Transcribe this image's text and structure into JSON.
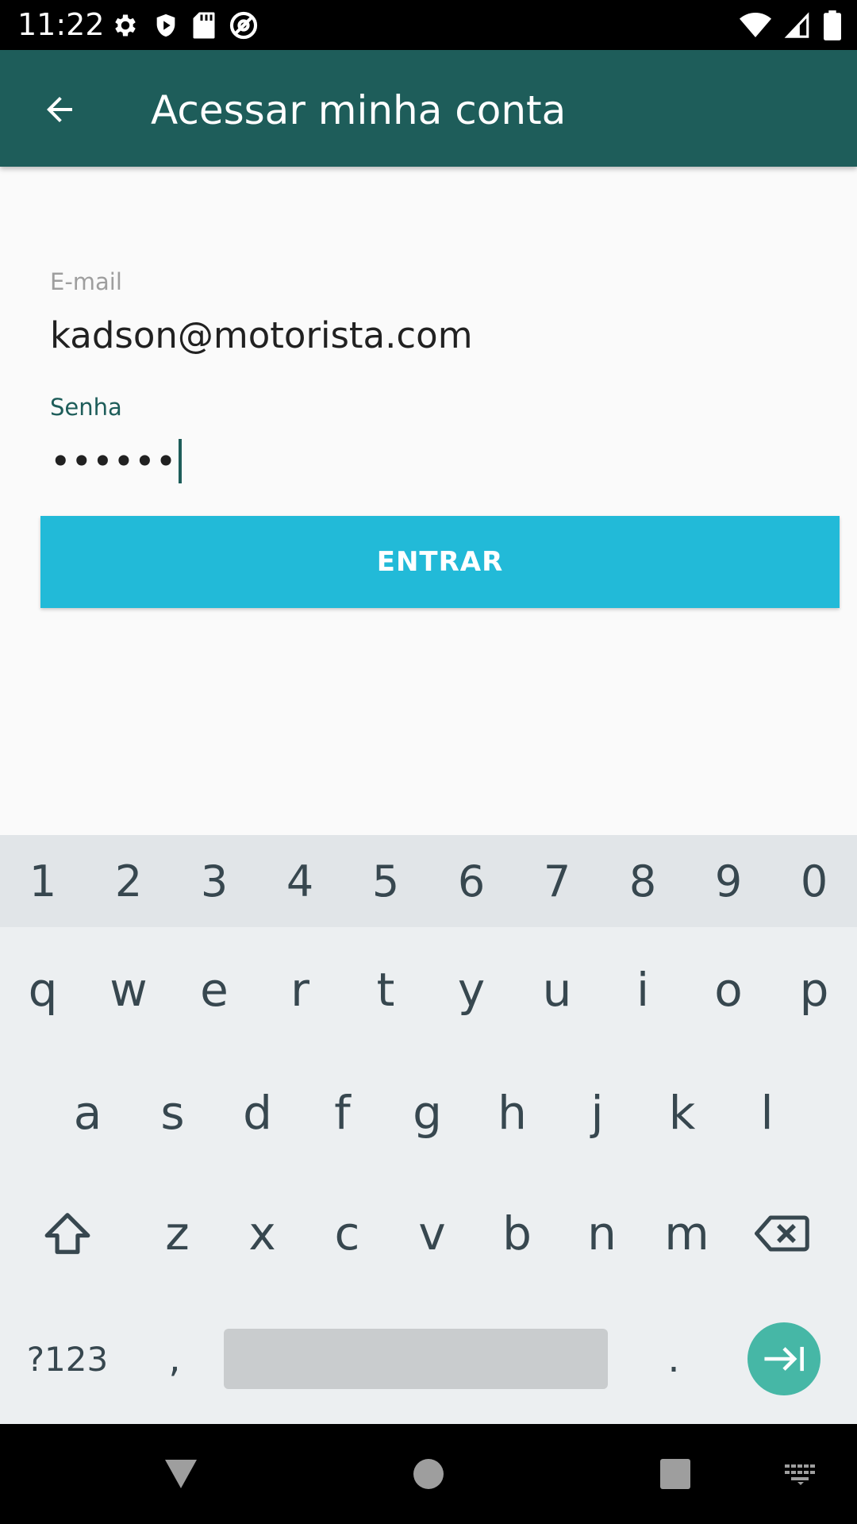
{
  "status_bar": {
    "time": "11:22",
    "left_icons": [
      "settings-icon",
      "shield-icon",
      "sd-card-icon",
      "at-sign-icon"
    ],
    "right_icons": [
      "wifi-icon",
      "signal-icon",
      "battery-icon"
    ]
  },
  "app_bar": {
    "title": "Acessar minha conta",
    "back_icon": "arrow-back-icon",
    "background": "#1e5d5a"
  },
  "form": {
    "email_label": "E-mail",
    "email_value": "kadson@motorista.com",
    "password_label": "Senha",
    "password_value": "••••••",
    "submit_label": "ENTRAR",
    "submit_color": "#22bad8"
  },
  "keyboard": {
    "numbers": [
      "1",
      "2",
      "3",
      "4",
      "5",
      "6",
      "7",
      "8",
      "9",
      "0"
    ],
    "row1": [
      "q",
      "w",
      "e",
      "r",
      "t",
      "y",
      "u",
      "i",
      "o",
      "p"
    ],
    "row2": [
      "a",
      "s",
      "d",
      "f",
      "g",
      "h",
      "j",
      "k",
      "l"
    ],
    "row3": [
      "z",
      "x",
      "c",
      "v",
      "b",
      "n",
      "m"
    ],
    "symbols_label": "?123",
    "comma": ",",
    "period": ".",
    "shift_icon": "shift-icon",
    "delete_icon": "backspace-icon",
    "go_icon": "tab-next-icon",
    "go_color": "#46b7a6"
  },
  "nav_bar": {
    "items": [
      "back-triangle-icon",
      "home-circle-icon",
      "recents-square-icon",
      "keyboard-switch-icon"
    ]
  }
}
